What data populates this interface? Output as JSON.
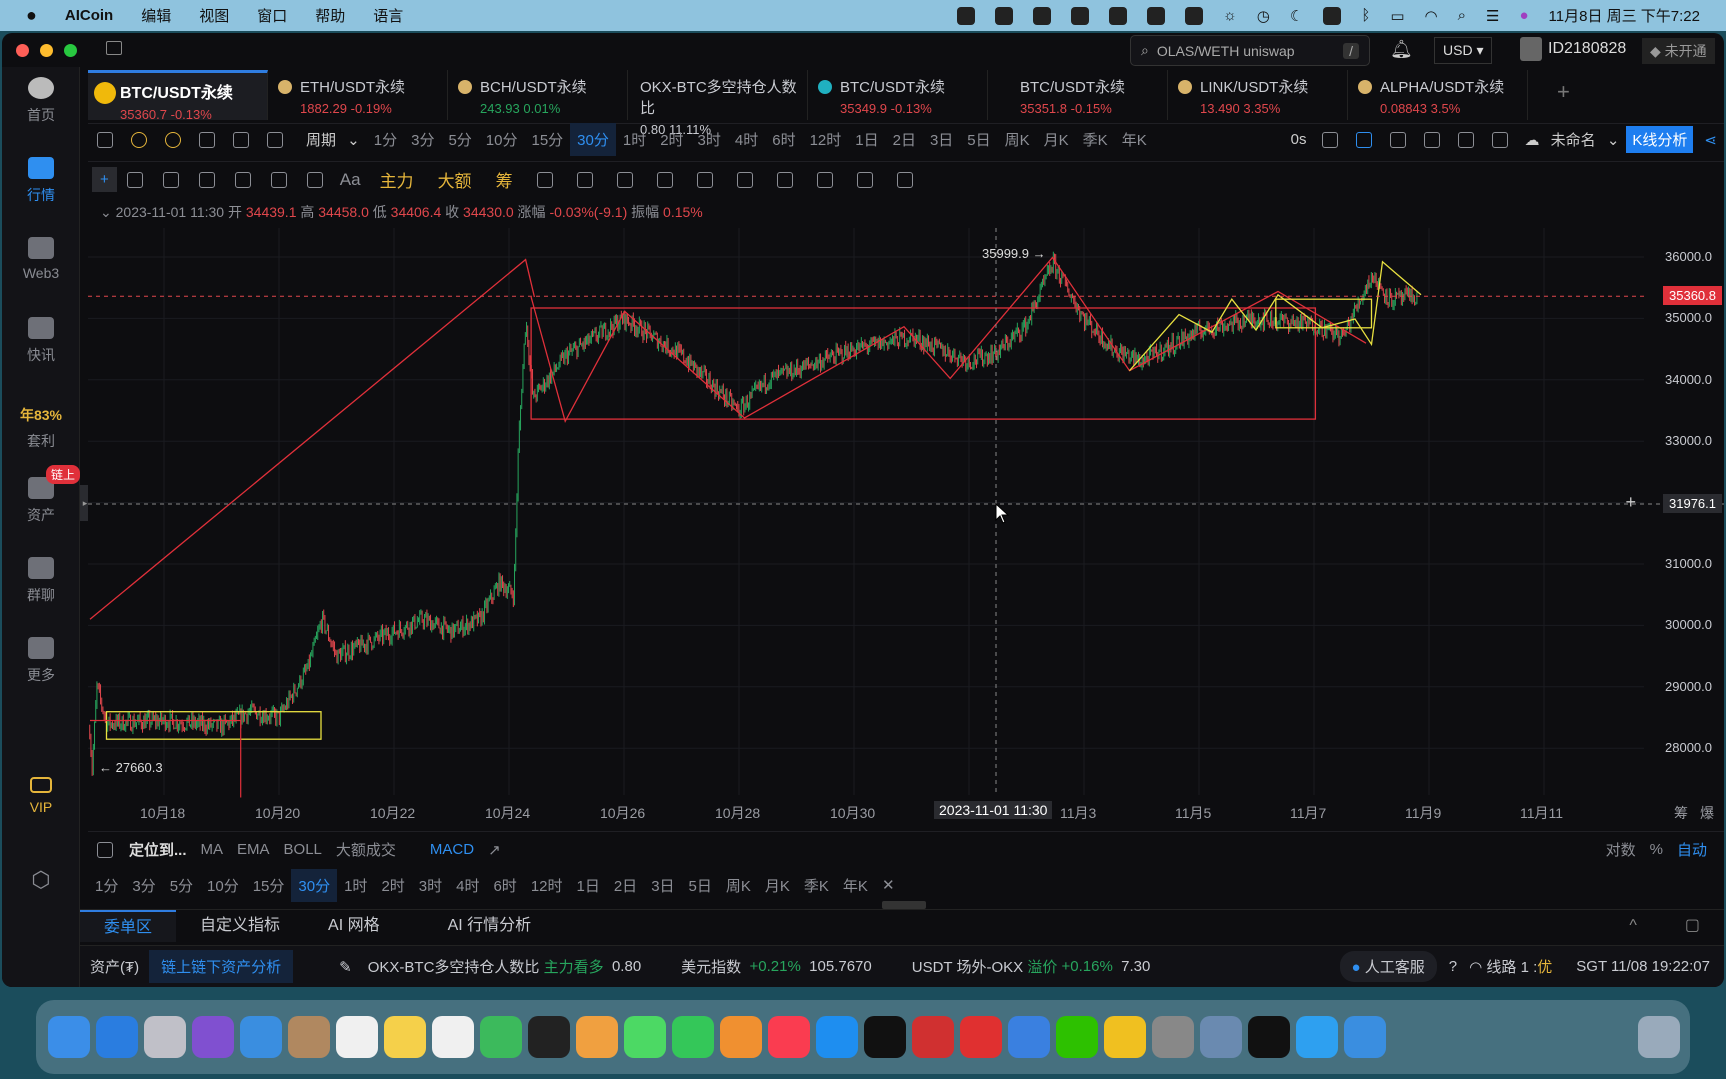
{
  "menubar": {
    "app": "AICoin",
    "items": [
      "编辑",
      "视图",
      "窗口",
      "帮助",
      "语言"
    ],
    "clock": "11月8日 周三 下午7:22"
  },
  "header": {
    "search_placeholder": "OLAS/WETH uniswap",
    "search_hotkey": "/",
    "currency": "USD",
    "user_id": "ID2180828",
    "vip_status": "未开通"
  },
  "tabs": [
    {
      "name": "BTC/USDT永续",
      "price": "35360.7",
      "change": "-0.13%",
      "dir": "down"
    },
    {
      "name": "ETH/USDT永续",
      "price": "1882.29",
      "change": "-0.19%",
      "dir": "down"
    },
    {
      "name": "BCH/USDT永续",
      "price": "243.93",
      "change": "0.01%",
      "dir": "up"
    },
    {
      "name": "OKX-BTC多空持仓人数比",
      "price": "0.80",
      "change": "11.11%",
      "dir": "flat"
    },
    {
      "name": "BTC/USDT永续",
      "price": "35349.9",
      "change": "-0.13%",
      "dir": "down"
    },
    {
      "name": "BTC/USDT永续",
      "price": "35351.8",
      "change": "-0.15%",
      "dir": "down"
    },
    {
      "name": "LINK/USDT永续",
      "price": "13.490",
      "change": "3.35%",
      "dir": "down"
    },
    {
      "name": "ALPHA/USDT永续",
      "price": "0.08843",
      "change": "3.5%",
      "dir": "down"
    }
  ],
  "sidebar": [
    {
      "label": "首页"
    },
    {
      "label": "行情",
      "active": true
    },
    {
      "label": "Web3"
    },
    {
      "label": "快讯"
    },
    {
      "label": "套利",
      "promo": "年83%"
    },
    {
      "label": "资产",
      "badge": "链上"
    },
    {
      "label": "群聊"
    },
    {
      "label": "更多"
    },
    {
      "label": "VIP"
    }
  ],
  "period_toolbar": {
    "period_label": "周期",
    "periods": [
      "1分",
      "3分",
      "5分",
      "10分",
      "15分",
      "30分",
      "1时",
      "2时",
      "3时",
      "4时",
      "6时",
      "12时",
      "1日",
      "2日",
      "3日",
      "5日",
      "周K",
      "月K",
      "季K",
      "年K"
    ],
    "selected": "30分",
    "countdown": "0s",
    "layout_name": "未命名",
    "analysis_button": "K线分析"
  },
  "draw_toolbar": {
    "text_tool": "Aa",
    "main_force": "主力",
    "big_order": "大额",
    "chips": "筹"
  },
  "ohlc": {
    "time": "2023-11-01 11:30",
    "open_label": "开",
    "open": "34439.1",
    "high_label": "高",
    "high": "34458.0",
    "low_label": "低",
    "low": "34406.4",
    "close_label": "收",
    "close": "34430.0",
    "change_label": "涨幅",
    "change": "-0.03%(-9.1)",
    "amp_label": "振幅",
    "amp": "0.15%"
  },
  "chart_data": {
    "type": "candlestick",
    "symbol": "BTC/USDT永续",
    "interval": "30分",
    "y_ticks": [
      "36000.0",
      "35000.0",
      "34000.0",
      "33000.0",
      "32000.0",
      "31000.0",
      "30000.0",
      "29000.0",
      "28000.0"
    ],
    "x_ticks": [
      "10月18",
      "10月20",
      "10月22",
      "10月24",
      "10月26",
      "10月28",
      "10月30",
      "11月3",
      "11月5",
      "11月7",
      "11月9",
      "11月11"
    ],
    "ylim": [
      27000,
      37000
    ],
    "current_price": "35360.8",
    "crosshair_price": "31976.1",
    "crosshair_time": "2023-11-01 11:30",
    "high_label": "35999.9 →",
    "low_label": "← 27660.3",
    "price_path": [
      [
        "2023-10-16 17:00",
        28300
      ],
      [
        "2023-10-16 18:00",
        27660
      ],
      [
        "2023-10-16 20:00",
        29000
      ],
      [
        "2023-10-17 00:00",
        28400
      ],
      [
        "2023-10-18 00:00",
        28450
      ],
      [
        "2023-10-19 00:00",
        28350
      ],
      [
        "2023-10-19 12:00",
        28600
      ],
      [
        "2023-10-20 00:00",
        28500
      ],
      [
        "2023-10-20 12:00",
        29300
      ],
      [
        "2023-10-20 18:00",
        30100
      ],
      [
        "2023-10-21 00:00",
        29500
      ],
      [
        "2023-10-22 00:00",
        29900
      ],
      [
        "2023-10-22 12:00",
        30100
      ],
      [
        "2023-10-23 00:00",
        29900
      ],
      [
        "2023-10-23 12:00",
        30100
      ],
      [
        "2023-10-23 20:00",
        30700
      ],
      [
        "2023-10-24 02:00",
        30500
      ],
      [
        "2023-10-24 04:00",
        33000
      ],
      [
        "2023-10-24 07:00",
        35000
      ],
      [
        "2023-10-24 10:00",
        33700
      ],
      [
        "2023-10-25 00:00",
        34400
      ],
      [
        "2023-10-26 00:00",
        35000
      ],
      [
        "2023-10-27 00:00",
        34400
      ],
      [
        "2023-10-28 00:00",
        33500
      ],
      [
        "2023-10-28 12:00",
        34000
      ],
      [
        "2023-10-30 00:00",
        34500
      ],
      [
        "2023-10-31 00:00",
        34700
      ],
      [
        "2023-11-01 00:00",
        34300
      ],
      [
        "2023-11-01 12:00",
        34450
      ],
      [
        "2023-11-02 00:00",
        34900
      ],
      [
        "2023-11-02 11:00",
        35900
      ],
      [
        "2023-11-03 00:00",
        35000
      ],
      [
        "2023-11-03 12:00",
        34500
      ],
      [
        "2023-11-04 00:00",
        34300
      ],
      [
        "2023-11-05 00:00",
        34800
      ],
      [
        "2023-11-06 00:00",
        35000
      ],
      [
        "2023-11-07 00:00",
        34900
      ],
      [
        "2023-11-07 12:00",
        34700
      ],
      [
        "2023-11-08 00:00",
        35700
      ],
      [
        "2023-11-08 08:00",
        35300
      ],
      [
        "2023-11-08 19:00",
        35360
      ]
    ],
    "up_color": "#27a55d",
    "down_color": "#e0474c",
    "axis_right_labels": [
      "筹",
      "爆"
    ]
  },
  "indicator_bar": {
    "locate": "定位到...",
    "indicators": [
      "MA",
      "EMA",
      "BOLL",
      "大额成交"
    ],
    "active": "MACD",
    "scale_options": [
      "对数",
      "%",
      "自动"
    ],
    "scale_active": "自动"
  },
  "bottom_tabs": [
    "委单区",
    "自定义指标",
    "AI 网格",
    "AI 行情分析"
  ],
  "status": {
    "assets": "资产(₮)",
    "asset_analysis": "链上链下资产分析",
    "ratio_name": "OKX-BTC多空持仓人数比",
    "ratio_signal": "主力看多",
    "ratio_value": "0.80",
    "dxy_name": "美元指数",
    "dxy_change": "+0.21%",
    "dxy_value": "105.7670",
    "otc_name": "USDT 场外-OKX",
    "otc_label": "溢价",
    "otc_change": "+0.16%",
    "otc_value": "7.30",
    "support": "人工客服",
    "line": "线路 1 :",
    "line_quality": "优",
    "time": "SGT 11/08 19:22:07"
  },
  "colors": {
    "accent": "#2f8ff0",
    "drawing_red": "#e0303a",
    "drawing_yellow": "#e8e040"
  }
}
